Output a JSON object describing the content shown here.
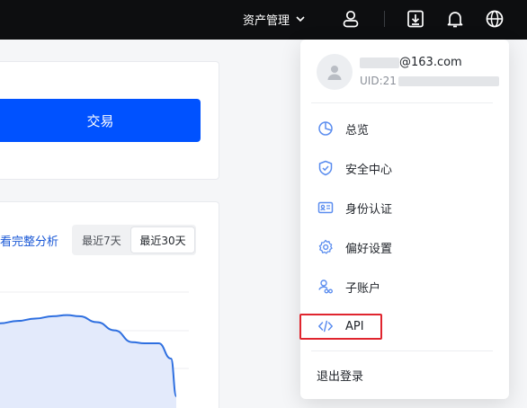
{
  "topbar": {
    "asset_management_label": "资产管理",
    "icons": [
      "chevron-down-icon",
      "user-icon",
      "download-icon",
      "bell-icon",
      "globe-icon"
    ]
  },
  "trade_card": {
    "trade_button_label": "交易"
  },
  "analysis_card": {
    "link_label": "看完整分析",
    "range_tabs": [
      {
        "label": "最近7天",
        "selected": false
      },
      {
        "label": "最近30天",
        "selected": true
      }
    ]
  },
  "chart_data": {
    "type": "area",
    "series": [
      {
        "x": [
          0,
          0.1,
          0.2,
          0.3,
          0.38,
          0.45,
          0.55,
          0.65,
          0.75,
          0.82,
          0.9,
          0.97,
          1.0
        ],
        "values": [
          0.72,
          0.74,
          0.76,
          0.78,
          0.79,
          0.78,
          0.73,
          0.66,
          0.56,
          0.55,
          0.55,
          0.42,
          0.1
        ]
      }
    ],
    "grid": true,
    "colors": {
      "line": "#2e6fe0",
      "fill": "#e3eafb"
    }
  },
  "user_menu": {
    "email_suffix": "@163.com",
    "uid_prefix": "UID:21",
    "items": [
      {
        "label": "总览",
        "icon": "pie-chart-icon"
      },
      {
        "label": "安全中心",
        "icon": "shield-icon"
      },
      {
        "label": "身份认证",
        "icon": "id-card-icon"
      },
      {
        "label": "偏好设置",
        "icon": "gear-icon"
      },
      {
        "label": "子账户",
        "icon": "sub-account-icon"
      },
      {
        "label": "API",
        "icon": "code-icon",
        "highlighted": true
      }
    ],
    "logout_label": "退出登录",
    "highlight_color": "#e0252e"
  }
}
